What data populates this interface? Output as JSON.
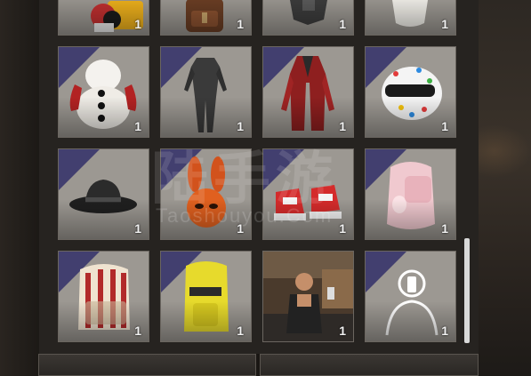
{
  "inventory": {
    "items": [
      {
        "name": "costume-partial",
        "qty": "1"
      },
      {
        "name": "backpack-brown-partial",
        "qty": "1"
      },
      {
        "name": "armor-partial",
        "qty": "1"
      },
      {
        "name": "white-item-partial",
        "qty": "1"
      },
      {
        "name": "snowman-costume",
        "qty": "1"
      },
      {
        "name": "dark-bodysuit",
        "qty": "1"
      },
      {
        "name": "red-long-coat",
        "qty": "1"
      },
      {
        "name": "confetti-helmet",
        "qty": "1"
      },
      {
        "name": "black-wide-brim-hat",
        "qty": "1"
      },
      {
        "name": "orange-bunny-mask",
        "qty": "1"
      },
      {
        "name": "red-white-sneakers",
        "qty": "1"
      },
      {
        "name": "pink-bunny-backpack",
        "qty": "1"
      },
      {
        "name": "striped-backpack",
        "qty": "1"
      },
      {
        "name": "yellow-backpack",
        "qty": "1"
      },
      {
        "name": "barista-emote",
        "qty": "1"
      },
      {
        "name": "selfie-emote",
        "qty": "1"
      }
    ]
  },
  "watermark": {
    "line1": "陆手游",
    "line2": "Taoshouyou.Com"
  },
  "colors": {
    "panel": "#262320",
    "slot": "#9c9892",
    "accent": "#3d3a6e"
  }
}
